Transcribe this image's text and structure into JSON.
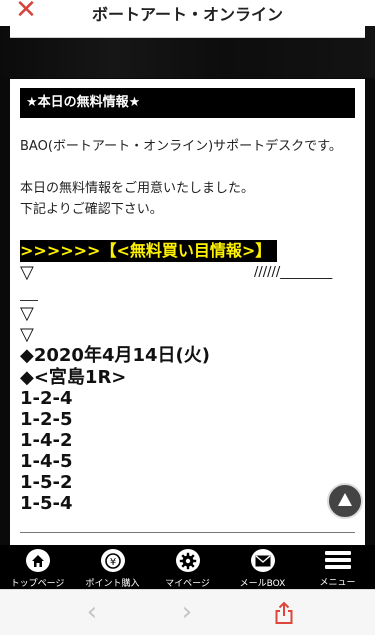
{
  "header": {
    "close_glyph": "✕",
    "title": "ボートアート・オンライン"
  },
  "card": {
    "heading": "★本日の無料情報★",
    "intro": "BAO(ボートアート・オンライン)サポートデスクです。",
    "line1": "本日の無料情報をご用意いたしました。",
    "line2": "下記よりご確認下さい。",
    "highlight": ">>>>>>【<無料買い目情報>】",
    "triangle": "▽",
    "slashes": "//////________",
    "date": "◆2020年4月14日(火)",
    "race": "◆<宮島1R>",
    "results": [
      "1-2-4",
      "1-2-5",
      "1-4-2",
      "1-4-5",
      "1-5-2",
      "1-5-4"
    ]
  },
  "tabbar": {
    "items": [
      {
        "label": "トップページ",
        "icon": "home-icon"
      },
      {
        "label": "ポイント購入",
        "icon": "coin-icon"
      },
      {
        "label": "マイページ",
        "icon": "gear-icon"
      },
      {
        "label": "メールBOX",
        "icon": "mail-icon"
      },
      {
        "label": "メニュー",
        "icon": "menu-icon"
      }
    ]
  },
  "browser": {
    "back_glyph": "‹",
    "forward_glyph": "›"
  },
  "colors": {
    "close": "#d9423a",
    "highlight_text": "#fff200",
    "share": "#e0453a"
  }
}
